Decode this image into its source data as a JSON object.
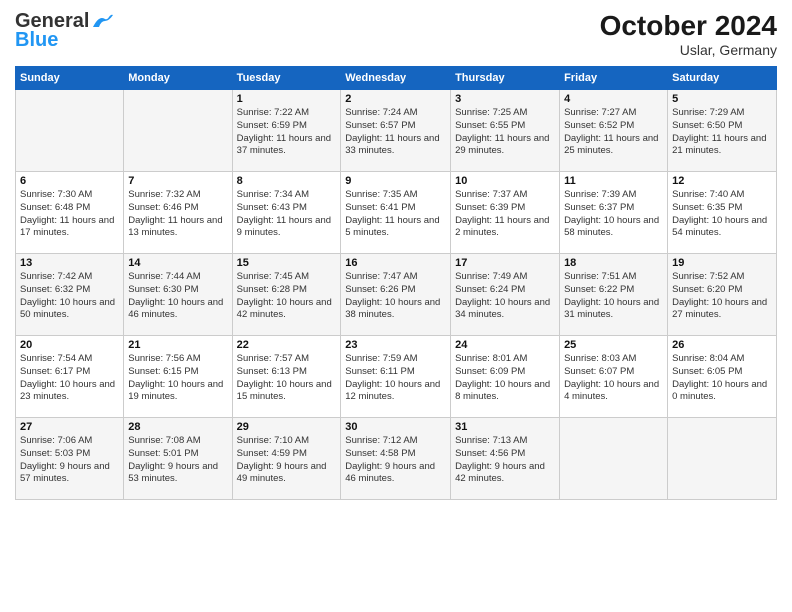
{
  "header": {
    "logo_line1": "General",
    "logo_line2": "Blue",
    "month": "October 2024",
    "location": "Uslar, Germany"
  },
  "weekdays": [
    "Sunday",
    "Monday",
    "Tuesday",
    "Wednesday",
    "Thursday",
    "Friday",
    "Saturday"
  ],
  "weeks": [
    [
      {
        "day": "",
        "sunrise": "",
        "sunset": "",
        "daylight": ""
      },
      {
        "day": "",
        "sunrise": "",
        "sunset": "",
        "daylight": ""
      },
      {
        "day": "1",
        "sunrise": "Sunrise: 7:22 AM",
        "sunset": "Sunset: 6:59 PM",
        "daylight": "Daylight: 11 hours and 37 minutes."
      },
      {
        "day": "2",
        "sunrise": "Sunrise: 7:24 AM",
        "sunset": "Sunset: 6:57 PM",
        "daylight": "Daylight: 11 hours and 33 minutes."
      },
      {
        "day": "3",
        "sunrise": "Sunrise: 7:25 AM",
        "sunset": "Sunset: 6:55 PM",
        "daylight": "Daylight: 11 hours and 29 minutes."
      },
      {
        "day": "4",
        "sunrise": "Sunrise: 7:27 AM",
        "sunset": "Sunset: 6:52 PM",
        "daylight": "Daylight: 11 hours and 25 minutes."
      },
      {
        "day": "5",
        "sunrise": "Sunrise: 7:29 AM",
        "sunset": "Sunset: 6:50 PM",
        "daylight": "Daylight: 11 hours and 21 minutes."
      }
    ],
    [
      {
        "day": "6",
        "sunrise": "Sunrise: 7:30 AM",
        "sunset": "Sunset: 6:48 PM",
        "daylight": "Daylight: 11 hours and 17 minutes."
      },
      {
        "day": "7",
        "sunrise": "Sunrise: 7:32 AM",
        "sunset": "Sunset: 6:46 PM",
        "daylight": "Daylight: 11 hours and 13 minutes."
      },
      {
        "day": "8",
        "sunrise": "Sunrise: 7:34 AM",
        "sunset": "Sunset: 6:43 PM",
        "daylight": "Daylight: 11 hours and 9 minutes."
      },
      {
        "day": "9",
        "sunrise": "Sunrise: 7:35 AM",
        "sunset": "Sunset: 6:41 PM",
        "daylight": "Daylight: 11 hours and 5 minutes."
      },
      {
        "day": "10",
        "sunrise": "Sunrise: 7:37 AM",
        "sunset": "Sunset: 6:39 PM",
        "daylight": "Daylight: 11 hours and 2 minutes."
      },
      {
        "day": "11",
        "sunrise": "Sunrise: 7:39 AM",
        "sunset": "Sunset: 6:37 PM",
        "daylight": "Daylight: 10 hours and 58 minutes."
      },
      {
        "day": "12",
        "sunrise": "Sunrise: 7:40 AM",
        "sunset": "Sunset: 6:35 PM",
        "daylight": "Daylight: 10 hours and 54 minutes."
      }
    ],
    [
      {
        "day": "13",
        "sunrise": "Sunrise: 7:42 AM",
        "sunset": "Sunset: 6:32 PM",
        "daylight": "Daylight: 10 hours and 50 minutes."
      },
      {
        "day": "14",
        "sunrise": "Sunrise: 7:44 AM",
        "sunset": "Sunset: 6:30 PM",
        "daylight": "Daylight: 10 hours and 46 minutes."
      },
      {
        "day": "15",
        "sunrise": "Sunrise: 7:45 AM",
        "sunset": "Sunset: 6:28 PM",
        "daylight": "Daylight: 10 hours and 42 minutes."
      },
      {
        "day": "16",
        "sunrise": "Sunrise: 7:47 AM",
        "sunset": "Sunset: 6:26 PM",
        "daylight": "Daylight: 10 hours and 38 minutes."
      },
      {
        "day": "17",
        "sunrise": "Sunrise: 7:49 AM",
        "sunset": "Sunset: 6:24 PM",
        "daylight": "Daylight: 10 hours and 34 minutes."
      },
      {
        "day": "18",
        "sunrise": "Sunrise: 7:51 AM",
        "sunset": "Sunset: 6:22 PM",
        "daylight": "Daylight: 10 hours and 31 minutes."
      },
      {
        "day": "19",
        "sunrise": "Sunrise: 7:52 AM",
        "sunset": "Sunset: 6:20 PM",
        "daylight": "Daylight: 10 hours and 27 minutes."
      }
    ],
    [
      {
        "day": "20",
        "sunrise": "Sunrise: 7:54 AM",
        "sunset": "Sunset: 6:17 PM",
        "daylight": "Daylight: 10 hours and 23 minutes."
      },
      {
        "day": "21",
        "sunrise": "Sunrise: 7:56 AM",
        "sunset": "Sunset: 6:15 PM",
        "daylight": "Daylight: 10 hours and 19 minutes."
      },
      {
        "day": "22",
        "sunrise": "Sunrise: 7:57 AM",
        "sunset": "Sunset: 6:13 PM",
        "daylight": "Daylight: 10 hours and 15 minutes."
      },
      {
        "day": "23",
        "sunrise": "Sunrise: 7:59 AM",
        "sunset": "Sunset: 6:11 PM",
        "daylight": "Daylight: 10 hours and 12 minutes."
      },
      {
        "day": "24",
        "sunrise": "Sunrise: 8:01 AM",
        "sunset": "Sunset: 6:09 PM",
        "daylight": "Daylight: 10 hours and 8 minutes."
      },
      {
        "day": "25",
        "sunrise": "Sunrise: 8:03 AM",
        "sunset": "Sunset: 6:07 PM",
        "daylight": "Daylight: 10 hours and 4 minutes."
      },
      {
        "day": "26",
        "sunrise": "Sunrise: 8:04 AM",
        "sunset": "Sunset: 6:05 PM",
        "daylight": "Daylight: 10 hours and 0 minutes."
      }
    ],
    [
      {
        "day": "27",
        "sunrise": "Sunrise: 7:06 AM",
        "sunset": "Sunset: 5:03 PM",
        "daylight": "Daylight: 9 hours and 57 minutes."
      },
      {
        "day": "28",
        "sunrise": "Sunrise: 7:08 AM",
        "sunset": "Sunset: 5:01 PM",
        "daylight": "Daylight: 9 hours and 53 minutes."
      },
      {
        "day": "29",
        "sunrise": "Sunrise: 7:10 AM",
        "sunset": "Sunset: 4:59 PM",
        "daylight": "Daylight: 9 hours and 49 minutes."
      },
      {
        "day": "30",
        "sunrise": "Sunrise: 7:12 AM",
        "sunset": "Sunset: 4:58 PM",
        "daylight": "Daylight: 9 hours and 46 minutes."
      },
      {
        "day": "31",
        "sunrise": "Sunrise: 7:13 AM",
        "sunset": "Sunset: 4:56 PM",
        "daylight": "Daylight: 9 hours and 42 minutes."
      },
      {
        "day": "",
        "sunrise": "",
        "sunset": "",
        "daylight": ""
      },
      {
        "day": "",
        "sunrise": "",
        "sunset": "",
        "daylight": ""
      }
    ]
  ]
}
